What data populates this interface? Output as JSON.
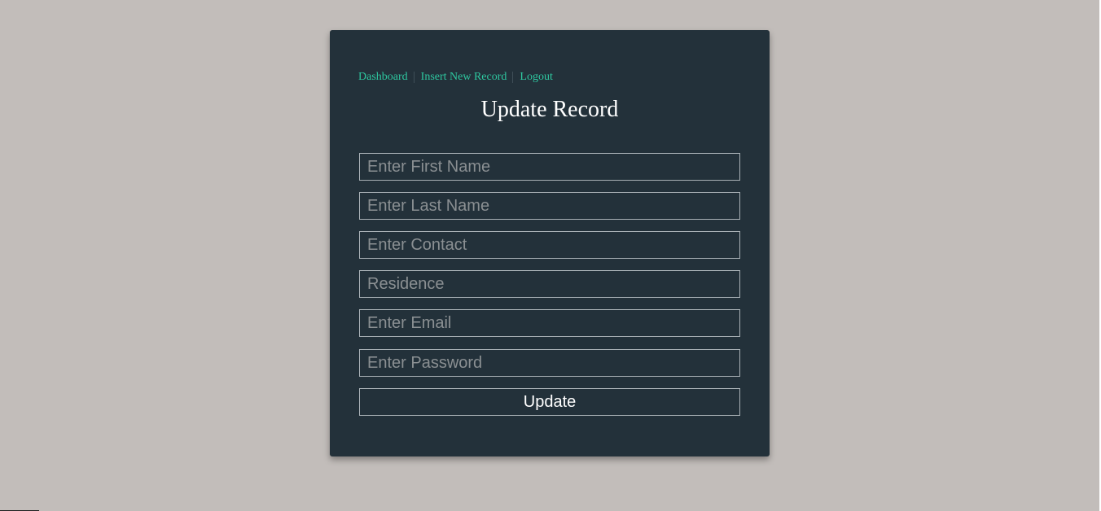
{
  "nav": {
    "links": [
      {
        "label": "Dashboard"
      },
      {
        "label": "Insert New Record"
      },
      {
        "label": "Logout"
      }
    ]
  },
  "form": {
    "title": "Update Record",
    "fields": {
      "first_name": {
        "placeholder": "Enter First Name",
        "value": ""
      },
      "last_name": {
        "placeholder": "Enter Last Name",
        "value": ""
      },
      "contact": {
        "placeholder": "Enter Contact",
        "value": ""
      },
      "residence": {
        "placeholder": "Residence",
        "value": ""
      },
      "email": {
        "placeholder": "Enter Email",
        "value": ""
      },
      "password": {
        "placeholder": "Enter Password",
        "value": ""
      }
    },
    "submit_label": "Update"
  },
  "colors": {
    "page_background": "#c2bdba",
    "card_background": "#23313a",
    "link": "#2ec8a0",
    "field_border": "#a9b1b6",
    "placeholder": "#8a8f92"
  }
}
